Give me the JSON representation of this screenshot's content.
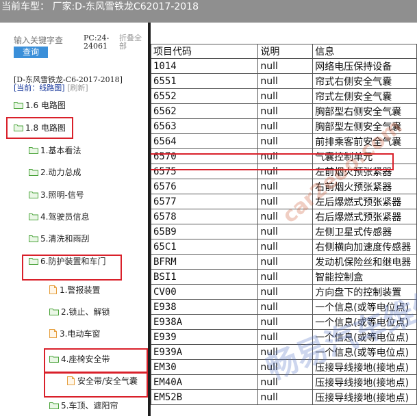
{
  "header": {
    "title_label": "当前车型：",
    "title_value": "厂家:D-东风雪铁龙C62017-2018"
  },
  "sidebar": {
    "search": {
      "placeholder": "输入关键字查",
      "button": "查询"
    },
    "pc_info": "PC:24-24061",
    "collapse_all": "折叠全部",
    "vehicle": "[D-东风雪铁龙-C6-2017-2018]",
    "current_label": "[当前：线路图]",
    "refresh_label": "[刷新]",
    "tree": [
      {
        "label": "1.6 电路图",
        "icon": "folder-icon"
      },
      {
        "label": "1.8 电路图",
        "icon": "folder-icon",
        "highlighted": true
      },
      {
        "label": "1.基本看法",
        "icon": "folder-icon"
      },
      {
        "label": "2.动力总成",
        "icon": "folder-icon"
      },
      {
        "label": "3.照明-信号",
        "icon": "folder-icon"
      },
      {
        "label": "4.驾驶员信息",
        "icon": "folder-icon"
      },
      {
        "label": "5.清洗和雨刮",
        "icon": "folder-icon"
      },
      {
        "label": "6.防护装置和车门",
        "icon": "folder-icon",
        "highlighted": true
      },
      {
        "label": "1.警报装置",
        "icon": "doc-icon"
      },
      {
        "label": "2.锁止、解锁",
        "icon": "folder-icon"
      },
      {
        "label": "3.电动车窗",
        "icon": "doc-icon"
      },
      {
        "label": "4.座椅安全带",
        "icon": "folder-icon",
        "highlighted": true
      },
      {
        "label": "安全带/安全气囊",
        "icon": "doc-icon",
        "highlighted": true
      },
      {
        "label": "5.车顶、遮阳帘",
        "icon": "folder-icon"
      }
    ]
  },
  "table": {
    "headers": [
      "项目代码",
      "说明",
      "信息"
    ],
    "rows": [
      [
        "1014",
        "null",
        "网络电压保持设备"
      ],
      [
        "6551",
        "null",
        "帘式右侧安全气囊"
      ],
      [
        "6552",
        "null",
        "帘式左侧安全气囊"
      ],
      [
        "6562",
        "null",
        "胸部型右侧安全气囊"
      ],
      [
        "6563",
        "null",
        "胸部型左侧安全气囊"
      ],
      [
        "6564",
        "null",
        "前排乘客前安全气囊"
      ],
      [
        "6570",
        "null",
        "气囊控制单元"
      ],
      [
        "6575",
        "null",
        "左前烟火预张紧器"
      ],
      [
        "6576",
        "null",
        "右前烟火预张紧器"
      ],
      [
        "6577",
        "null",
        "左后爆燃式预张紧器"
      ],
      [
        "6578",
        "null",
        "右后爆燃式预张紧器"
      ],
      [
        "65B9",
        "null",
        "左侧卫星式传感器"
      ],
      [
        "65C1",
        "null",
        "右侧横向加速度传感器"
      ],
      [
        "BFRM",
        "null",
        "发动机保险丝和继电器"
      ],
      [
        "BSI1",
        "null",
        "智能控制盒"
      ],
      [
        "CV00",
        "null",
        "方向盘下的控制装置"
      ],
      [
        "E938",
        "null",
        "一个信息(或等电位点)"
      ],
      [
        "E938A",
        "null",
        "一个信息(或等电位点)"
      ],
      [
        "E939",
        "null",
        "一个信息(或等电位点)"
      ],
      [
        "E939A",
        "null",
        "一个信息(或等电位点)"
      ],
      [
        "EM30",
        "null",
        "压接导线接地(接地点)"
      ],
      [
        "EM40A",
        "null",
        "压接导线接地(接地点)"
      ],
      [
        "EM52B",
        "null",
        "压接导线接地(接地点)"
      ]
    ],
    "highlighted_row": 6
  },
  "watermarks": [
    "car2eoo.com",
    "畅易汽车维修"
  ]
}
